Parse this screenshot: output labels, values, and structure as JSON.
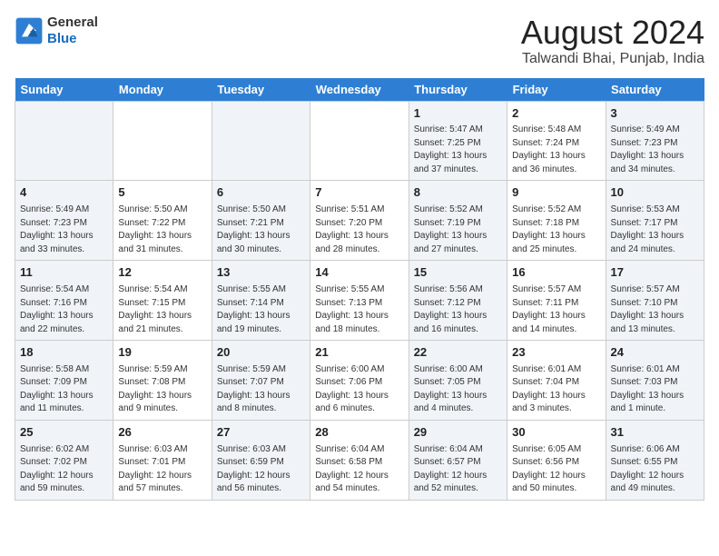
{
  "header": {
    "logo_line1": "General",
    "logo_line2": "Blue",
    "main_title": "August 2024",
    "sub_title": "Talwandi Bhai, Punjab, India"
  },
  "days_of_week": [
    "Sunday",
    "Monday",
    "Tuesday",
    "Wednesday",
    "Thursday",
    "Friday",
    "Saturday"
  ],
  "weeks": [
    [
      {
        "day": "",
        "info": ""
      },
      {
        "day": "",
        "info": ""
      },
      {
        "day": "",
        "info": ""
      },
      {
        "day": "",
        "info": ""
      },
      {
        "day": "1",
        "info": "Sunrise: 5:47 AM\nSunset: 7:25 PM\nDaylight: 13 hours\nand 37 minutes."
      },
      {
        "day": "2",
        "info": "Sunrise: 5:48 AM\nSunset: 7:24 PM\nDaylight: 13 hours\nand 36 minutes."
      },
      {
        "day": "3",
        "info": "Sunrise: 5:49 AM\nSunset: 7:23 PM\nDaylight: 13 hours\nand 34 minutes."
      }
    ],
    [
      {
        "day": "4",
        "info": "Sunrise: 5:49 AM\nSunset: 7:23 PM\nDaylight: 13 hours\nand 33 minutes."
      },
      {
        "day": "5",
        "info": "Sunrise: 5:50 AM\nSunset: 7:22 PM\nDaylight: 13 hours\nand 31 minutes."
      },
      {
        "day": "6",
        "info": "Sunrise: 5:50 AM\nSunset: 7:21 PM\nDaylight: 13 hours\nand 30 minutes."
      },
      {
        "day": "7",
        "info": "Sunrise: 5:51 AM\nSunset: 7:20 PM\nDaylight: 13 hours\nand 28 minutes."
      },
      {
        "day": "8",
        "info": "Sunrise: 5:52 AM\nSunset: 7:19 PM\nDaylight: 13 hours\nand 27 minutes."
      },
      {
        "day": "9",
        "info": "Sunrise: 5:52 AM\nSunset: 7:18 PM\nDaylight: 13 hours\nand 25 minutes."
      },
      {
        "day": "10",
        "info": "Sunrise: 5:53 AM\nSunset: 7:17 PM\nDaylight: 13 hours\nand 24 minutes."
      }
    ],
    [
      {
        "day": "11",
        "info": "Sunrise: 5:54 AM\nSunset: 7:16 PM\nDaylight: 13 hours\nand 22 minutes."
      },
      {
        "day": "12",
        "info": "Sunrise: 5:54 AM\nSunset: 7:15 PM\nDaylight: 13 hours\nand 21 minutes."
      },
      {
        "day": "13",
        "info": "Sunrise: 5:55 AM\nSunset: 7:14 PM\nDaylight: 13 hours\nand 19 minutes."
      },
      {
        "day": "14",
        "info": "Sunrise: 5:55 AM\nSunset: 7:13 PM\nDaylight: 13 hours\nand 18 minutes."
      },
      {
        "day": "15",
        "info": "Sunrise: 5:56 AM\nSunset: 7:12 PM\nDaylight: 13 hours\nand 16 minutes."
      },
      {
        "day": "16",
        "info": "Sunrise: 5:57 AM\nSunset: 7:11 PM\nDaylight: 13 hours\nand 14 minutes."
      },
      {
        "day": "17",
        "info": "Sunrise: 5:57 AM\nSunset: 7:10 PM\nDaylight: 13 hours\nand 13 minutes."
      }
    ],
    [
      {
        "day": "18",
        "info": "Sunrise: 5:58 AM\nSunset: 7:09 PM\nDaylight: 13 hours\nand 11 minutes."
      },
      {
        "day": "19",
        "info": "Sunrise: 5:59 AM\nSunset: 7:08 PM\nDaylight: 13 hours\nand 9 minutes."
      },
      {
        "day": "20",
        "info": "Sunrise: 5:59 AM\nSunset: 7:07 PM\nDaylight: 13 hours\nand 8 minutes."
      },
      {
        "day": "21",
        "info": "Sunrise: 6:00 AM\nSunset: 7:06 PM\nDaylight: 13 hours\nand 6 minutes."
      },
      {
        "day": "22",
        "info": "Sunrise: 6:00 AM\nSunset: 7:05 PM\nDaylight: 13 hours\nand 4 minutes."
      },
      {
        "day": "23",
        "info": "Sunrise: 6:01 AM\nSunset: 7:04 PM\nDaylight: 13 hours\nand 3 minutes."
      },
      {
        "day": "24",
        "info": "Sunrise: 6:01 AM\nSunset: 7:03 PM\nDaylight: 13 hours\nand 1 minute."
      }
    ],
    [
      {
        "day": "25",
        "info": "Sunrise: 6:02 AM\nSunset: 7:02 PM\nDaylight: 12 hours\nand 59 minutes."
      },
      {
        "day": "26",
        "info": "Sunrise: 6:03 AM\nSunset: 7:01 PM\nDaylight: 12 hours\nand 57 minutes."
      },
      {
        "day": "27",
        "info": "Sunrise: 6:03 AM\nSunset: 6:59 PM\nDaylight: 12 hours\nand 56 minutes."
      },
      {
        "day": "28",
        "info": "Sunrise: 6:04 AM\nSunset: 6:58 PM\nDaylight: 12 hours\nand 54 minutes."
      },
      {
        "day": "29",
        "info": "Sunrise: 6:04 AM\nSunset: 6:57 PM\nDaylight: 12 hours\nand 52 minutes."
      },
      {
        "day": "30",
        "info": "Sunrise: 6:05 AM\nSunset: 6:56 PM\nDaylight: 12 hours\nand 50 minutes."
      },
      {
        "day": "31",
        "info": "Sunrise: 6:06 AM\nSunset: 6:55 PM\nDaylight: 12 hours\nand 49 minutes."
      }
    ]
  ]
}
